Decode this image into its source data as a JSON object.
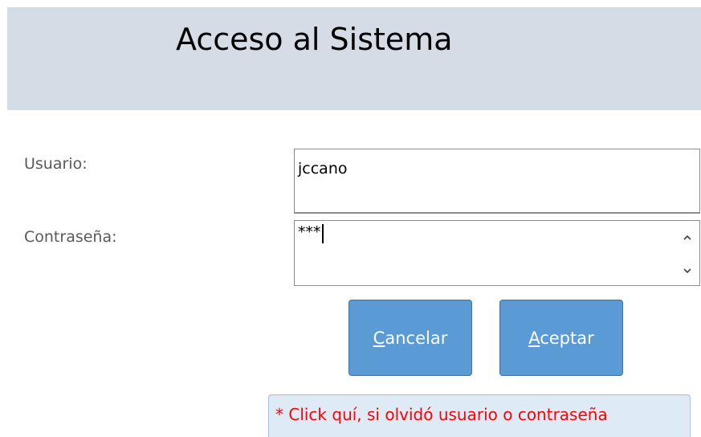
{
  "header": {
    "title": "Acceso al Sistema"
  },
  "form": {
    "user_label": "Usuario:",
    "user_value": "jccano",
    "pass_label": "Contraseña:",
    "pass_value": "***"
  },
  "buttons": {
    "cancel_access_key": "C",
    "cancel_rest": "ancelar",
    "accept_access_key": "A",
    "accept_rest": "ceptar"
  },
  "forgot_link": "* Click quí, si olvidó usuario o contraseña",
  "icons": {
    "scroll_up": "chevron-up-icon",
    "scroll_down": "chevron-down-icon"
  },
  "colors": {
    "header_band": "#d6dce5",
    "button": "#5b9bd5",
    "link_text": "#ff0000",
    "link_bg": "#deebf7"
  }
}
